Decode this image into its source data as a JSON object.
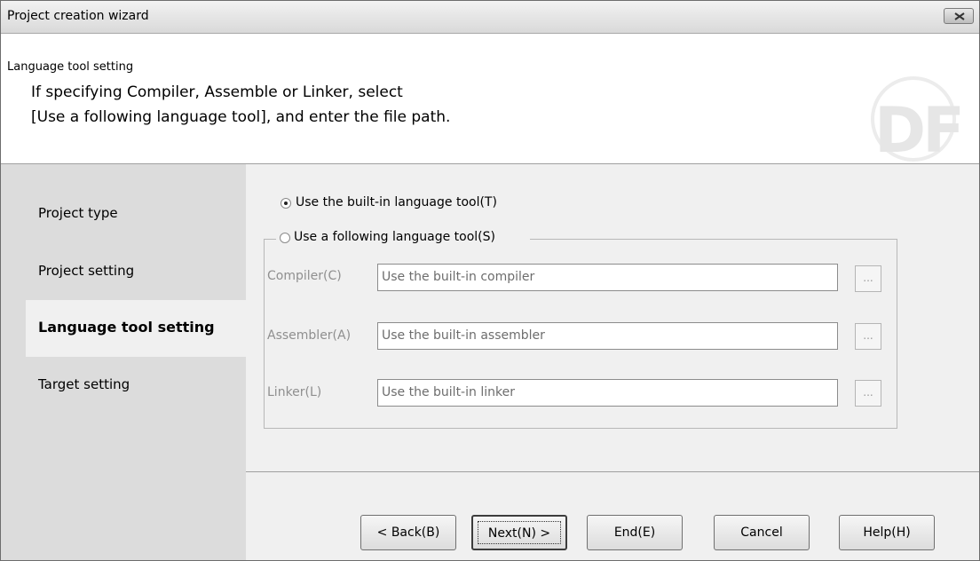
{
  "window": {
    "title": "Project creation wizard"
  },
  "header": {
    "title": "Language tool setting",
    "line1": "If specifying Compiler, Assemble or Linker, select",
    "line2": "[Use a following language tool], and enter the file path.",
    "logo_text": "DF"
  },
  "sidebar": {
    "items": [
      {
        "label": "Project type"
      },
      {
        "label": "Project setting"
      },
      {
        "label": "Language tool setting",
        "active": true
      },
      {
        "label": "Target setting"
      }
    ]
  },
  "options": {
    "builtin_label": "Use the built-in language tool(T)",
    "builtin_selected": true,
    "following_label": "Use a following language tool(S)",
    "following_selected": false
  },
  "fields": {
    "compiler": {
      "label": "Compiler(C)",
      "value": "Use the built-in compiler",
      "browse": "..."
    },
    "assembler": {
      "label": "Assembler(A)",
      "value": "Use the built-in assembler",
      "browse": "..."
    },
    "linker": {
      "label": "Linker(L)",
      "value": "Use the built-in linker",
      "browse": "..."
    }
  },
  "buttons": {
    "back": "< Back(B)",
    "next": "Next(N) >",
    "end": "End(E)",
    "cancel": "Cancel",
    "help": "Help(H)"
  },
  "colors": {
    "sidebar_bg": "#dcdcdc",
    "active_item_bg": "#f0f0f0",
    "disabled_text": "#8f8f8f"
  }
}
